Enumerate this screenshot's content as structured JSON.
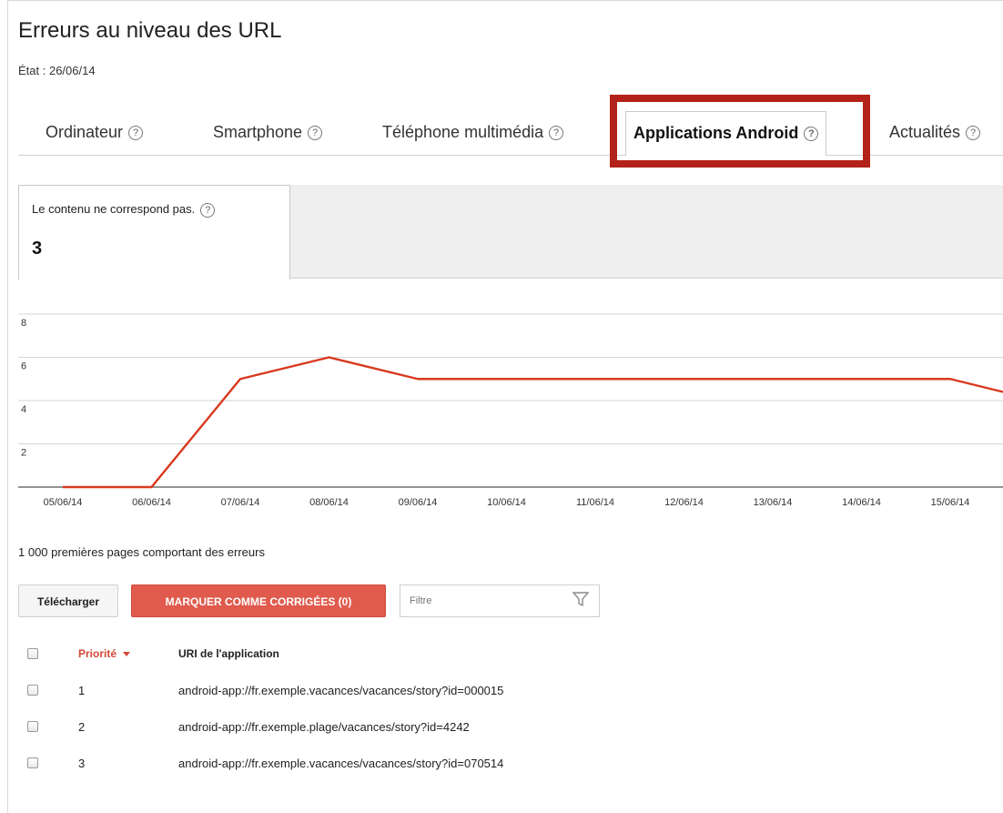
{
  "header": {
    "title": "Erreurs au niveau des URL",
    "date": "État : 26/06/14"
  },
  "tabs": [
    {
      "label": "Ordinateur",
      "active": false
    },
    {
      "label": "Smartphone",
      "active": false
    },
    {
      "label": "Téléphone multimédia",
      "active": false
    },
    {
      "label": "Applications Android",
      "active": true
    },
    {
      "label": "Actualités",
      "active": false
    }
  ],
  "help_glyph": "?",
  "metric": {
    "label": "Le contenu ne correspond pas.",
    "value": "3"
  },
  "colors": {
    "line": "#d9391f",
    "highlight": "#b3221a",
    "mark_button": "#e05b4d",
    "priority_header": "#d14836"
  },
  "chart_data": {
    "type": "line",
    "title": "",
    "xlabel": "",
    "ylabel": "",
    "categories": [
      "05/06/14",
      "06/06/14",
      "07/06/14",
      "08/06/14",
      "09/06/14",
      "10/06/14",
      "11/06/14",
      "12/06/14",
      "13/06/14",
      "14/06/14",
      "15/06/14"
    ],
    "y_ticks": [
      2,
      4,
      6,
      8
    ],
    "ylim": [
      0,
      8
    ],
    "grid": true,
    "series": [
      {
        "values": [
          0,
          0,
          5,
          6,
          5,
          5,
          5,
          5,
          5,
          5,
          5,
          4.4
        ]
      }
    ]
  },
  "list": {
    "caption": "1 000 premières pages comportant des erreurs",
    "download_label": "Télécharger",
    "mark_label": "MARQUER COMME CORRIGÉES (0)",
    "filter_placeholder": "Filtre",
    "columns": {
      "priority": "Priorité",
      "uri": "URI de l'application"
    },
    "rows": [
      {
        "priority": "1",
        "uri": "android-app://fr.exemple.vacances/vacances/story?id=000015"
      },
      {
        "priority": "2",
        "uri": "android-app://fr.exemple.plage/vacances/story?id=4242"
      },
      {
        "priority": "3",
        "uri": "android-app://fr.exemple.vacances/vacances/story?id=070514"
      }
    ]
  }
}
